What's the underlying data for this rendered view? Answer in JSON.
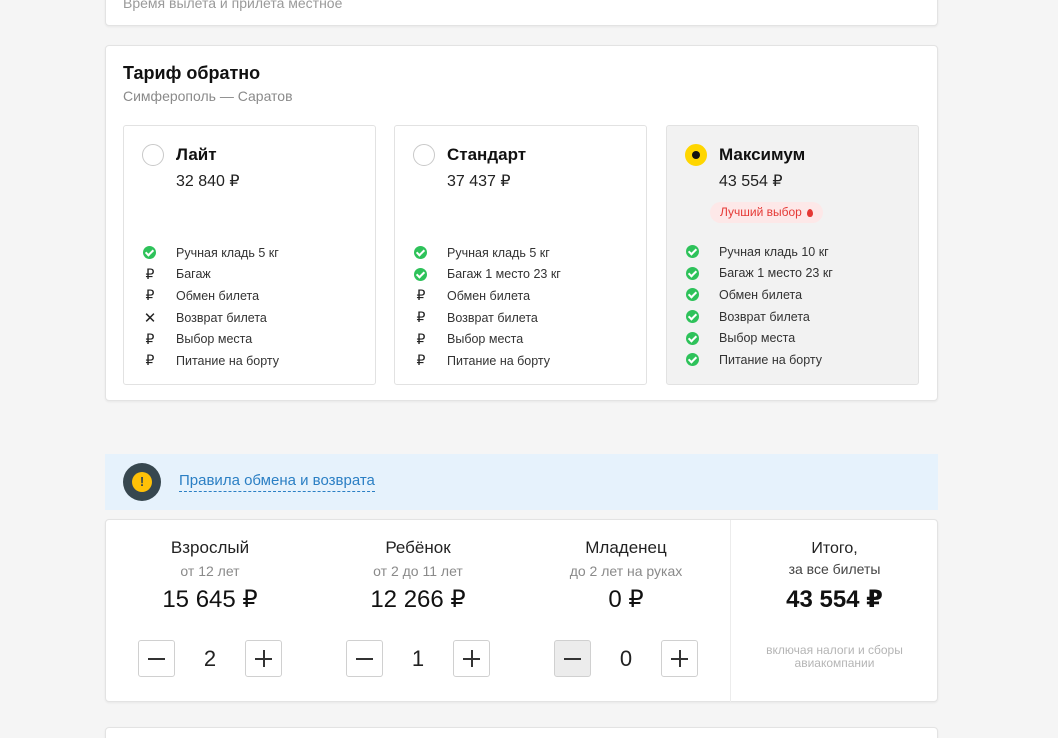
{
  "top_note": "Время вылета и прилета местное",
  "fare": {
    "title": "Тариф обратно",
    "route": "Симферополь — Саратов",
    "tariffs": [
      {
        "name": "Лайт",
        "price": "32 840 ₽",
        "selected": false,
        "features": [
          {
            "icon": "check",
            "label": "Ручная кладь 5 кг"
          },
          {
            "icon": "ruble",
            "label": "Багаж"
          },
          {
            "icon": "ruble",
            "label": "Обмен билета"
          },
          {
            "icon": "cross",
            "label": "Возврат билета"
          },
          {
            "icon": "ruble",
            "label": "Выбор места"
          },
          {
            "icon": "ruble",
            "label": "Питание на борту"
          }
        ]
      },
      {
        "name": "Стандарт",
        "price": "37 437 ₽",
        "selected": false,
        "features": [
          {
            "icon": "check",
            "label": "Ручная кладь 5 кг"
          },
          {
            "icon": "check",
            "label": "Багаж 1 место 23 кг"
          },
          {
            "icon": "ruble",
            "label": "Обмен билета"
          },
          {
            "icon": "ruble",
            "label": "Возврат билета"
          },
          {
            "icon": "ruble",
            "label": "Выбор места"
          },
          {
            "icon": "ruble",
            "label": "Питание на борту"
          }
        ]
      },
      {
        "name": "Максимум",
        "price": "43 554 ₽",
        "selected": true,
        "badge": "Лучший выбор",
        "features": [
          {
            "icon": "check",
            "label": "Ручная кладь 10 кг"
          },
          {
            "icon": "check",
            "label": "Багаж 1 место 23 кг"
          },
          {
            "icon": "check",
            "label": "Обмен билета"
          },
          {
            "icon": "check",
            "label": "Возврат билета"
          },
          {
            "icon": "check",
            "label": "Выбор места"
          },
          {
            "icon": "check",
            "label": "Питание на борту"
          }
        ]
      }
    ]
  },
  "rules": {
    "link": "Правила обмена и возврата",
    "icon": "warning-icon"
  },
  "passengers": [
    {
      "type": "Взрослый",
      "age": "от 12 лет",
      "price": "15 645 ₽",
      "count": "2",
      "minus_disabled": false
    },
    {
      "type": "Ребёнок",
      "age": "от 2 до 11 лет",
      "price": "12 266 ₽",
      "count": "1",
      "minus_disabled": false
    },
    {
      "type": "Младенец",
      "age": "до 2 лет на руках",
      "price": "0 ₽",
      "count": "0",
      "minus_disabled": true
    }
  ],
  "total": {
    "title": "Итого,",
    "subtitle": "за все билеты",
    "price": "43 554 ₽",
    "note": "включая налоги и сборы авиакомпании"
  },
  "colors": {
    "accent_yellow": "#ffd600",
    "check_green": "#2ec25a",
    "link_blue": "#2b7fc4",
    "badge_red": "#e53935",
    "rules_bg": "#e6f2fc"
  }
}
